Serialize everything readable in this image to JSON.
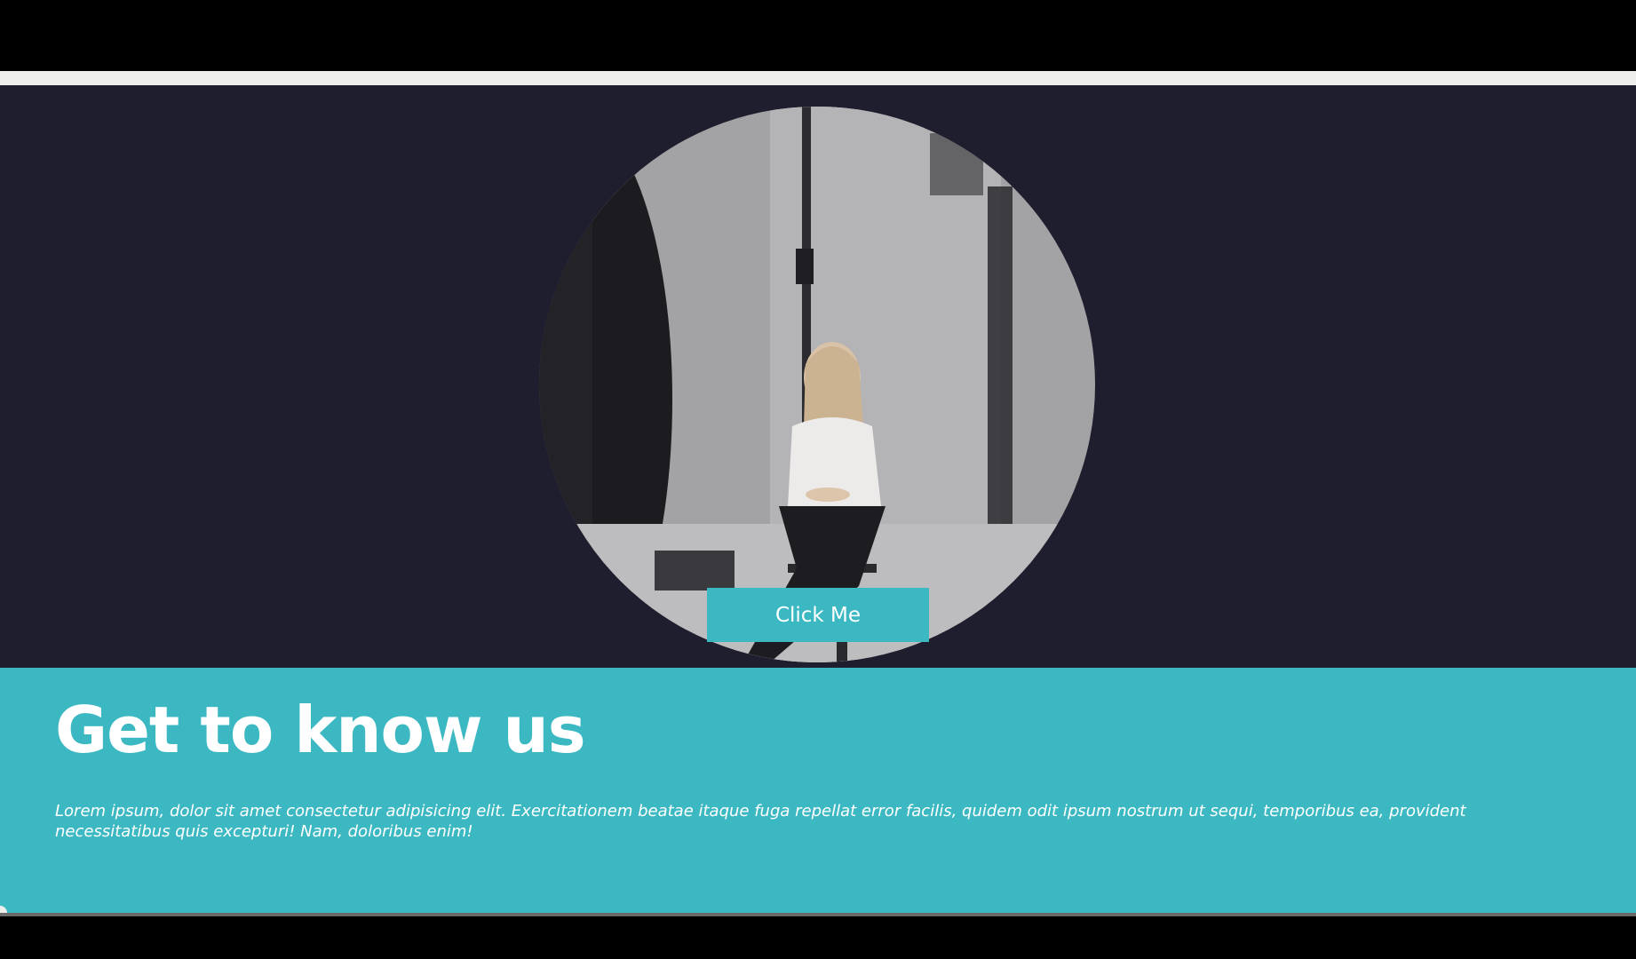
{
  "hero": {
    "photo_alt": "Woman seated on a stool in a photo studio",
    "button_label": "Click Me"
  },
  "about": {
    "title": "Get to know us",
    "text": "Lorem ipsum, dolor sit amet consectetur adipisicing elit. Exercitationem beatae itaque fuga repellat error facilis, quidem odit ipsum nostrum ut sequi, temporibus ea, provident necessitatibus quis excepturi! Nam, doloribus enim!"
  },
  "colors": {
    "background": "#000000",
    "hero_background": "#1f1e2e",
    "accent": "#3cb8c3",
    "text_light": "#ffffff"
  }
}
